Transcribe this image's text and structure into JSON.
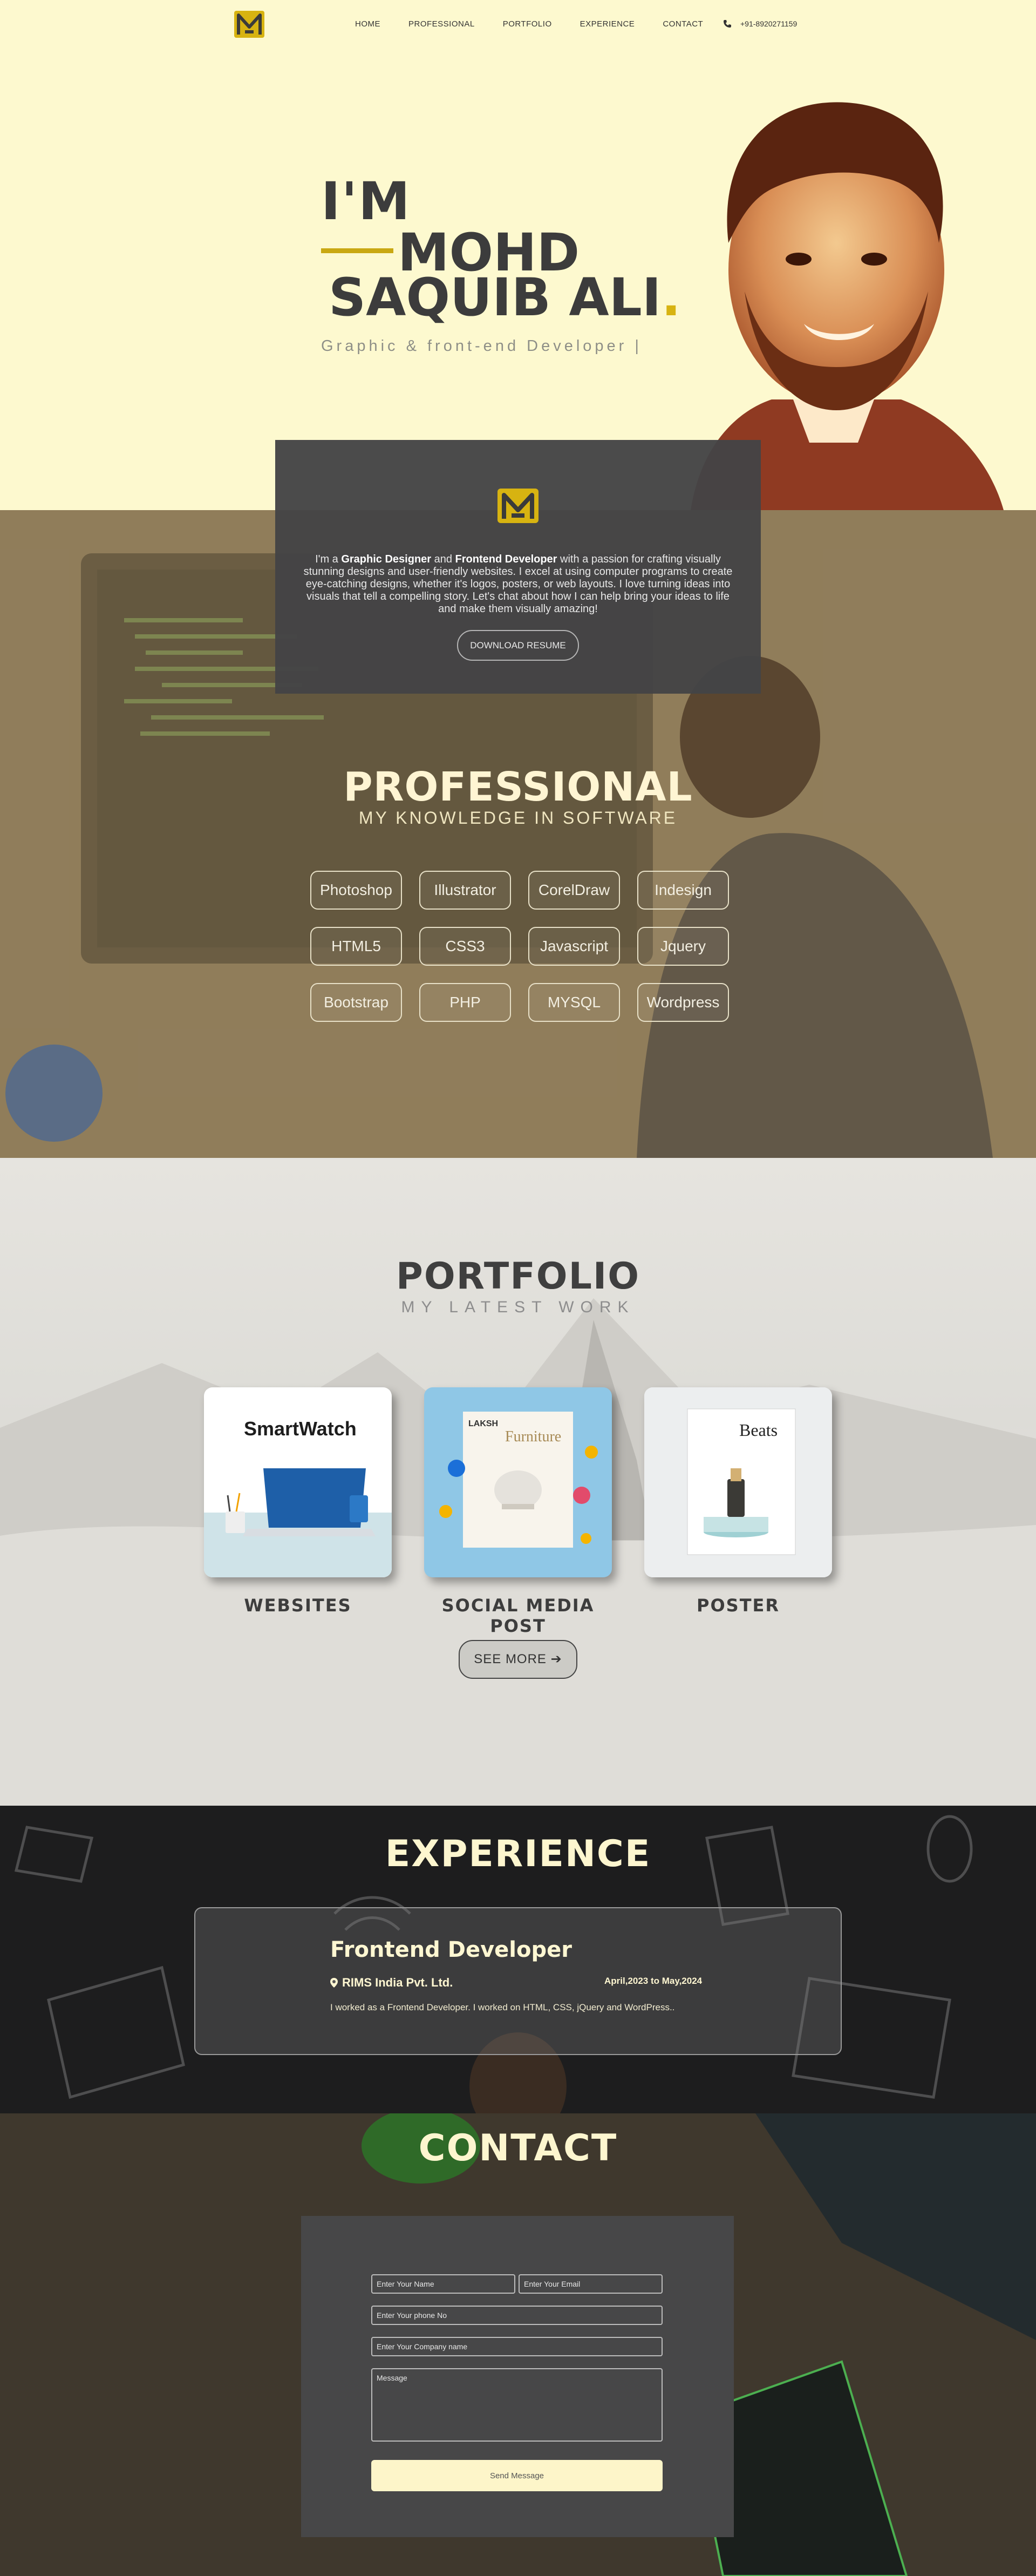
{
  "nav": {
    "links": [
      "HOME",
      "PROFESSIONAL",
      "PORTFOLIO",
      "EXPERIENCE",
      "CONTACT"
    ],
    "phone": "+91-8920271159"
  },
  "hero": {
    "im": "I'M",
    "name_line1": "MOHD",
    "name_line2": "SAQUIB ALI",
    "name_dot": ".",
    "subtitle": "Graphic & front-end Developer |"
  },
  "about": {
    "text_intro": "I'm a ",
    "text_role1": "Graphic Designer",
    "text_and": " and ",
    "text_role2": "Frontend Developer",
    "text_rest": " with a passion for crafting visually stunning designs and user-friendly websites. I excel at using computer programs to create eye-catching designs, whether it's logos, posters, or web layouts. I love turning ideas into visuals that tell a compelling story. Let's chat about how I can help bring your ideas to life and make them visually amazing!",
    "resume_button": "DOWNLOAD RESUME"
  },
  "professional": {
    "title": "PROFESSIONAL",
    "subtitle": "MY KNOWLEDGE IN SOFTWARE",
    "skills": [
      "Photoshop",
      "Illustrator",
      "CorelDraw",
      "Indesign",
      "HTML5",
      "CSS3",
      "Javascript",
      "Jquery",
      "Bootstrap",
      "PHP",
      "MYSQL",
      "Wordpress"
    ]
  },
  "portfolio": {
    "title": "PORTFOLIO",
    "subtitle": "MY LATEST WORK",
    "card_web_caption": "SmartWatch",
    "card_social_brand": "LAKSH",
    "card_social_headline": "Furniture",
    "card_poster_brand": "Beats",
    "labels": [
      "WEBSITES",
      "SOCIAL MEDIA POST",
      "POSTER"
    ],
    "see_more": "SEE MORE"
  },
  "experience": {
    "title": "EXPERIENCE",
    "role": "Frontend Developer",
    "company": "RIMS India Pvt. Ltd.",
    "dates": "April,2023 to May,2024",
    "description": "I worked as a Frontend Developer. I worked on HTML, CSS, jQuery and WordPress.."
  },
  "contact": {
    "title": "CONTACT",
    "name_placeholder": "Enter Your Name",
    "email_placeholder": "Enter Your Email",
    "phone_placeholder": "Enter Your phone No",
    "company_placeholder": "Enter Your Company name",
    "message_placeholder": "Message",
    "send_button": "Send Message"
  },
  "colors": {
    "accent": "#d7b311",
    "cream": "#fdf9cf",
    "dark_card": "#444446"
  }
}
